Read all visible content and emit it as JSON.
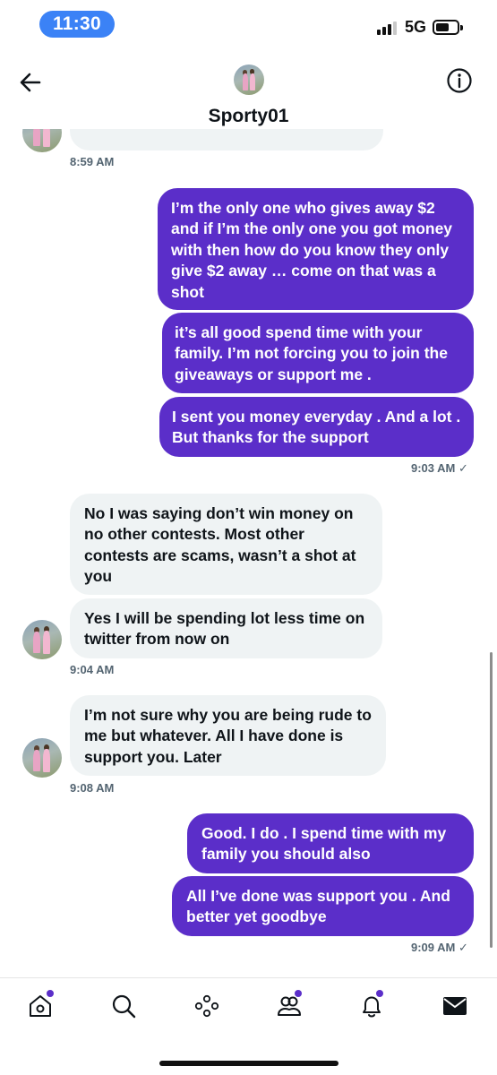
{
  "status_bar": {
    "time": "11:30",
    "network": "5G"
  },
  "header": {
    "title": "Sporty01",
    "back_icon": "arrow-left-icon",
    "info_icon": "info-icon"
  },
  "messages": [
    {
      "id": "m0",
      "direction": "incoming",
      "text": ""
    },
    {
      "id": "m1",
      "direction": "outgoing",
      "text": "I’m the only one who gives away $2 and if I’m the only one you got money with then how do you know they only give $2 away … come on that was a shot"
    },
    {
      "id": "m2",
      "direction": "outgoing",
      "text": "it’s all good spend time with your family. I’m not forcing you to join the giveaways or support me ."
    },
    {
      "id": "m3",
      "direction": "outgoing",
      "text": "I sent you money everyday . And a lot . But thanks for the support"
    },
    {
      "id": "m4",
      "direction": "incoming",
      "text": "No I was saying don’t win money on no other contests. Most other contests are scams, wasn’t a shot at you"
    },
    {
      "id": "m5",
      "direction": "incoming",
      "text": "Yes I will be spending lot less time on twitter from now on"
    },
    {
      "id": "m6",
      "direction": "incoming",
      "text": "I’m not sure why you are being rude to me but whatever. All I have done is support you. Later"
    },
    {
      "id": "m7",
      "direction": "outgoing",
      "text": "Good.  I do . I spend time with my family you should also"
    },
    {
      "id": "m8",
      "direction": "outgoing",
      "text": "All I’ve done was support you . And better yet goodbye"
    }
  ],
  "timestamps": {
    "t1": "8:59 AM",
    "t2": "9:03 AM ✓",
    "t3": "9:04 AM",
    "t4": "9:08 AM",
    "t5": "9:09 AM ✓"
  },
  "bottom_nav": [
    {
      "icon": "home-icon",
      "has_dot": true
    },
    {
      "icon": "search-icon",
      "has_dot": false
    },
    {
      "icon": "spaces-icon",
      "has_dot": false
    },
    {
      "icon": "communities-icon",
      "has_dot": true
    },
    {
      "icon": "bell-icon",
      "has_dot": true
    },
    {
      "icon": "mail-icon",
      "has_dot": false
    }
  ],
  "colors": {
    "outgoing_bubble": "#5b2ec9",
    "incoming_bubble": "#eff3f4",
    "time_pill": "#3b82f6",
    "notification_dot": "#5b2ec9"
  }
}
